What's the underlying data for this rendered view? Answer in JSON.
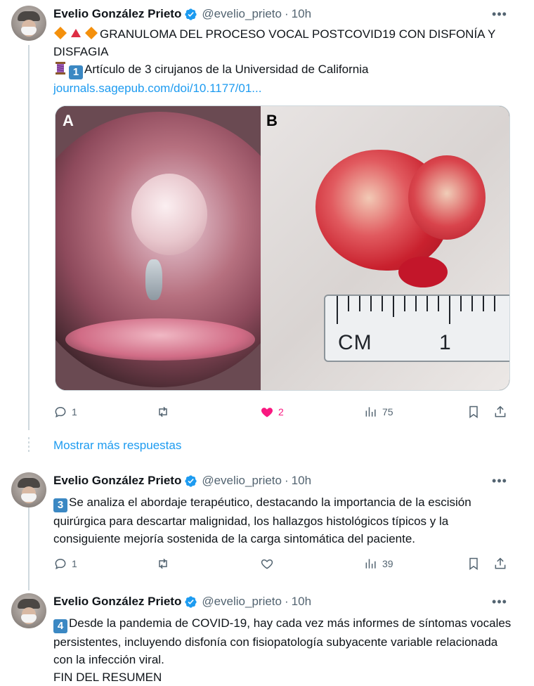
{
  "colors": {
    "accent": "#1d9bf0",
    "like": "#f91880",
    "muted": "#536471",
    "text": "#0f1419"
  },
  "tweets": [
    {
      "author_name": "Evelio González Prieto",
      "author_handle": "@evelio_prieto",
      "separator": "·",
      "time": "10h",
      "more_label": "•••",
      "line1": "GRANULOMA DEL PROCESO VOCAL POSTCOVID19 CON DISFONÍA Y DISFAGIA",
      "line2": "Artículo de 3 cirujanos de la Universidad de California",
      "number_badge": "1",
      "link": "journals.sagepub.com/doi/10.1177/01...",
      "media": {
        "label_a": "A",
        "label_b": "B",
        "ruler_unit": "CM",
        "ruler_value": "1"
      },
      "replies": "1",
      "retweets": "",
      "likes": "2",
      "liked": true,
      "views": "75"
    },
    {
      "author_name": "Evelio González Prieto",
      "author_handle": "@evelio_prieto",
      "separator": "·",
      "time": "10h",
      "more_label": "•••",
      "number_badge": "3",
      "text": "Se analiza el abordaje terapéutico, destacando la importancia de la escisión quirúrgica para descartar malignidad, los hallazgos histológicos típicos y la consiguiente mejoría sostenida de la carga sintomática del paciente.",
      "replies": "1",
      "retweets": "",
      "likes": "",
      "liked": false,
      "views": "39"
    },
    {
      "author_name": "Evelio González Prieto",
      "author_handle": "@evelio_prieto",
      "separator": "·",
      "time": "10h",
      "more_label": "•••",
      "number_badge": "4",
      "text": "Desde la pandemia de COVID-19, hay cada vez más informes de síntomas vocales persistentes, incluyendo disfonía con fisiopatología subyacente variable relacionada con la infección viral.",
      "text2": "FIN DEL RESUMEN"
    }
  ],
  "show_more_replies": "Mostrar más respuestas",
  "icons": [
    "reply-icon",
    "retweet-icon",
    "like-icon",
    "views-icon",
    "bookmark-icon",
    "share-icon",
    "verified-badge-icon"
  ]
}
